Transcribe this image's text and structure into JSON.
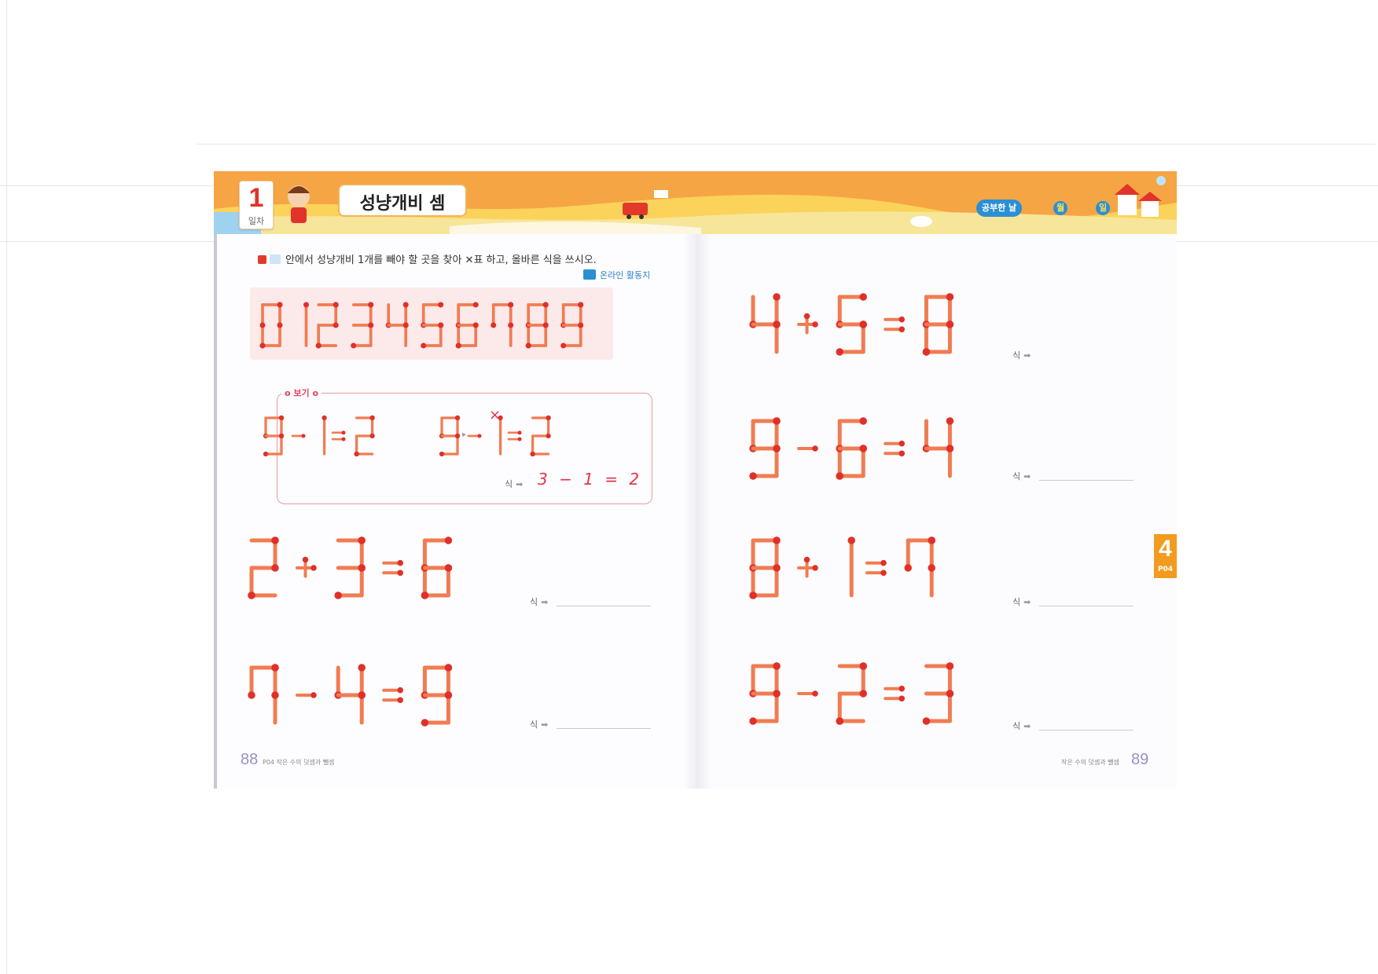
{
  "banner": {
    "day_number": "1",
    "day_label": "일차",
    "title": "성냥개비 셈",
    "study_date_label": "공부한 날",
    "month_label": "월",
    "day_unit_label": "일"
  },
  "instruction": {
    "text": "안에서 성냥개비 1개를 빼야 할 곳을 찾아 ✕표 하고, 올바른 식을 쓰시오.",
    "online_label": "온라인 활동지"
  },
  "digits_row": "0123456789",
  "example": {
    "label": "보기",
    "before": "9-1=2",
    "after": "9-1=2",
    "mark": "×",
    "sik_label": "식",
    "answer": "3 − 1 = 2"
  },
  "problems": [
    {
      "expr": "2+3=6",
      "sik_label": "식"
    },
    {
      "expr": "7-4=9",
      "sik_label": "식"
    },
    {
      "expr": "4+5=8",
      "sik_label": "식"
    },
    {
      "expr": "9-6=4",
      "sik_label": "식"
    },
    {
      "expr": "8+1=7",
      "sik_label": "식"
    },
    {
      "expr": "9-2=3",
      "sik_label": "식"
    }
  ],
  "chapter_tab": {
    "number": "4",
    "code": "P04"
  },
  "footer": {
    "left_page_number": "88",
    "left_text": "P04 작은 수의 덧셈과 뺄셈",
    "right_text": "작은 수의 덧셈과 뺄셈",
    "right_page_number": "89"
  },
  "colors": {
    "match_stick": "#f07c52",
    "match_head": "#e0302a",
    "banner_orange": "#f5a34a",
    "accent_red": "#e2334a"
  }
}
